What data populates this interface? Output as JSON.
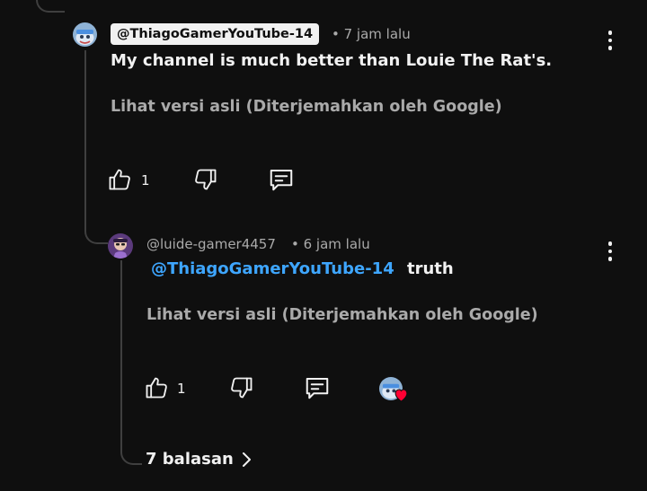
{
  "comment": {
    "author": "@ThiagoGamerYouTube-14",
    "time": "• 7 jam lalu",
    "text": "My channel is much better than Louie The Rat's.",
    "translate_link": "Lihat versi asli (Diterjemahkan oleh Google)",
    "like_count": "1",
    "icons": {
      "avatar": "blue-character-avatar",
      "like": "thumbs-up-icon",
      "dislike": "thumbs-down-icon",
      "reply": "reply-icon",
      "menu": "more-vertical-icon"
    }
  },
  "reply": {
    "author": "@luide-gamer4457",
    "time": "• 6 jam lalu",
    "mention": "@ThiagoGamerYouTube-14",
    "text": "truth",
    "translate_link": "Lihat versi asli (Diterjemahkan oleh Google)",
    "like_count": "1",
    "icons": {
      "avatar": "purple-character-avatar",
      "like": "thumbs-up-icon",
      "dislike": "thumbs-down-icon",
      "reply": "reply-icon",
      "creator_heart": "creator-heart-icon",
      "menu": "more-vertical-icon"
    }
  },
  "replies_toggle": {
    "label": "7 balasan",
    "icon": "chevron-right-icon"
  },
  "colors": {
    "background": "#0f0f0f",
    "text": "#f1f1f1",
    "secondary_text": "#aaaaaa",
    "mention": "#3ea6ff",
    "heart": "#ff0033",
    "thread_line": "#3f3f3f"
  }
}
